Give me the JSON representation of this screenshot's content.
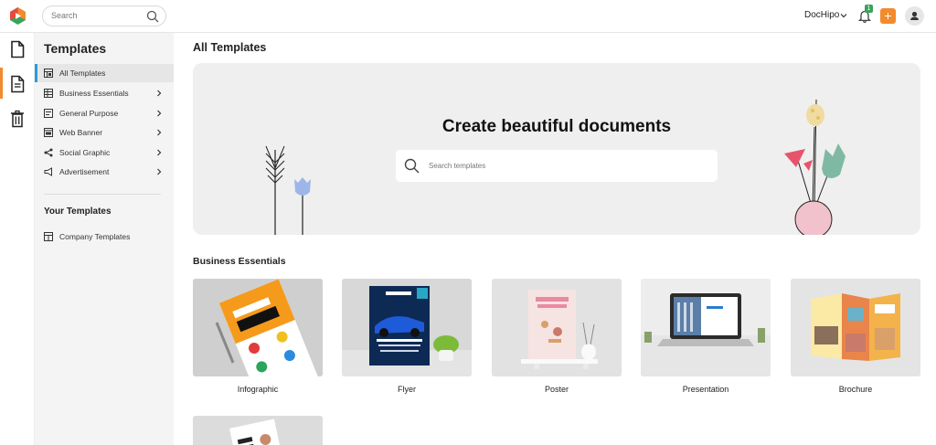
{
  "topbar": {
    "search_placeholder": "Search",
    "account_name": "DocHipo",
    "notification_count": "1"
  },
  "sidebar": {
    "title": "Templates",
    "items": [
      {
        "label": "All Templates",
        "icon": "grid-icon",
        "active": true
      },
      {
        "label": "Business Essentials",
        "icon": "table-icon"
      },
      {
        "label": "General Purpose",
        "icon": "doc-lines-icon"
      },
      {
        "label": "Web Banner",
        "icon": "browser-icon"
      },
      {
        "label": "Social Graphic",
        "icon": "share-icon"
      },
      {
        "label": "Advertisement",
        "icon": "megaphone-icon"
      }
    ],
    "your_templates_title": "Your Templates",
    "your_items": [
      {
        "label": "Company Templates",
        "icon": "building-icon"
      }
    ]
  },
  "main": {
    "title": "All Templates",
    "hero": {
      "title": "Create beautiful documents",
      "search_placeholder": "Search templates"
    },
    "section_title": "Business Essentials",
    "cards": [
      {
        "label": "Infographic"
      },
      {
        "label": "Flyer"
      },
      {
        "label": "Poster"
      },
      {
        "label": "Presentation"
      },
      {
        "label": "Brochure"
      }
    ]
  },
  "colors": {
    "accent": "#f28a2e",
    "active_indicator": "#2b9be0",
    "badge": "#3aa35c"
  }
}
